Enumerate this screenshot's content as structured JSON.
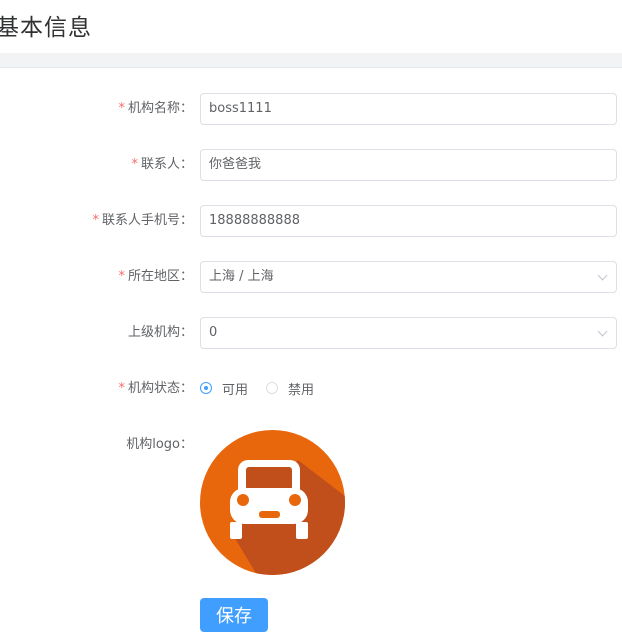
{
  "page": {
    "title": "基本信息"
  },
  "form": {
    "org_name": {
      "label": "机构名称：",
      "required": true,
      "value": "boss1111"
    },
    "contact": {
      "label": "联系人：",
      "required": true,
      "value": "你爸爸我"
    },
    "contact_phone": {
      "label": "联系人手机号：",
      "required": true,
      "value": "18888888888"
    },
    "region": {
      "label": "所在地区：",
      "required": true,
      "value": "上海 / 上海"
    },
    "parent_org": {
      "label": "上级机构：",
      "required": false,
      "value": "0"
    },
    "status": {
      "label": "机构状态：",
      "required": true,
      "options": [
        {
          "label": "可用",
          "checked": true
        },
        {
          "label": "禁用",
          "checked": false
        }
      ]
    },
    "logo": {
      "label": "机构logo：",
      "icon": "car-icon"
    },
    "save_label": "保存",
    "required_mark": "*"
  },
  "colors": {
    "primary": "#409eff",
    "required": "#f56c6c",
    "logo_bg": "#e8670c",
    "logo_shadow": "#c04f1c"
  }
}
